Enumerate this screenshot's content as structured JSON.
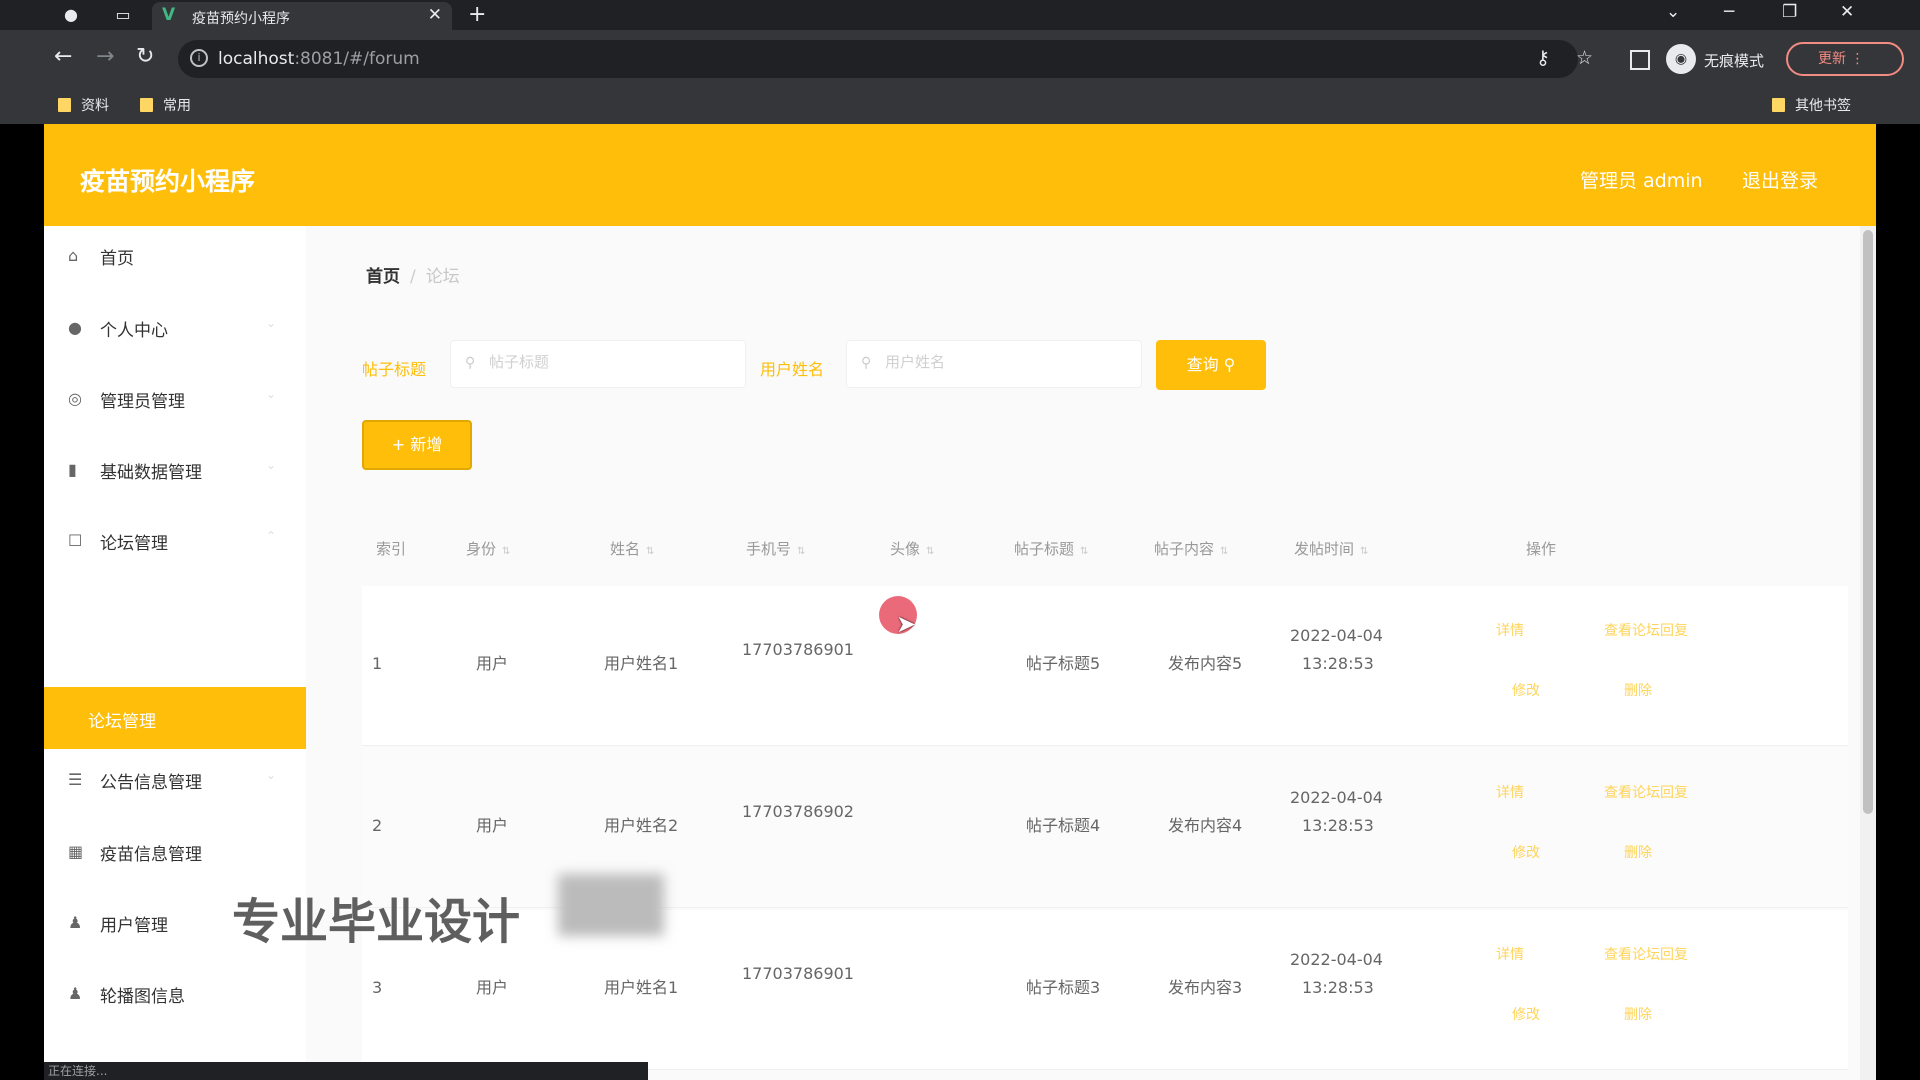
{
  "browser": {
    "tab_title": "疫苗预约小程序",
    "url_host": "localhost",
    "url_rest": ":8081/#/forum",
    "incognito_label": "无痕模式",
    "update_label": "更新",
    "bookmarks": [
      "资料",
      "常用"
    ],
    "other_bookmarks": "其他书签"
  },
  "app": {
    "title": "疫苗预约小程序",
    "user": "管理员 admin",
    "logout": "退出登录"
  },
  "sidebar": {
    "items": [
      {
        "label": "首页",
        "icon": "home-icon"
      },
      {
        "label": "个人中心",
        "icon": "user-icon"
      },
      {
        "label": "管理员管理",
        "icon": "admin-icon"
      },
      {
        "label": "基础数据管理",
        "icon": "bar-chart-icon"
      },
      {
        "label": "论坛管理",
        "icon": "forum-icon"
      },
      {
        "label": "公告信息管理",
        "icon": "list-icon"
      },
      {
        "label": "疫苗信息管理",
        "icon": "grid-icon"
      },
      {
        "label": "用户管理",
        "icon": "person-icon"
      },
      {
        "label": "轮播图信息",
        "icon": "person-icon"
      }
    ],
    "active_sub": "论坛管理"
  },
  "breadcrumb": {
    "home": "首页",
    "current": "论坛"
  },
  "search": {
    "field1_label": "帖子标题",
    "field1_placeholder": "帖子标题",
    "field2_label": "用户姓名",
    "field2_placeholder": "用户姓名",
    "search_button": "查询",
    "add_button": "+ 新增"
  },
  "table": {
    "headers": [
      "索引",
      "身份",
      "姓名",
      "手机号",
      "头像",
      "帖子标题",
      "帖子内容",
      "发帖时间",
      "操作"
    ],
    "rows": [
      {
        "index": "1",
        "role": "用户",
        "name": "用户姓名1",
        "phone1": "17703786901",
        "phone2": "",
        "title": "帖子标题5",
        "content": "发布内容5",
        "date": "2022-04-04",
        "time": "13:28:53"
      },
      {
        "index": "2",
        "role": "用户",
        "name": "用户姓名2",
        "phone1": "17703786902",
        "phone2": "",
        "title": "帖子标题4",
        "content": "发布内容4",
        "date": "2022-04-04",
        "time": "13:28:53"
      },
      {
        "index": "3",
        "role": "用户",
        "name": "用户姓名1",
        "phone1": "17703786901",
        "phone2": "",
        "title": "帖子标题3",
        "content": "发布内容3",
        "date": "2022-04-04",
        "time": "13:28:53"
      }
    ],
    "ops": [
      "详情",
      "查看论坛回复",
      "修改",
      "删除"
    ]
  },
  "watermark": "专业毕业设计",
  "status_text": "正在连接..."
}
